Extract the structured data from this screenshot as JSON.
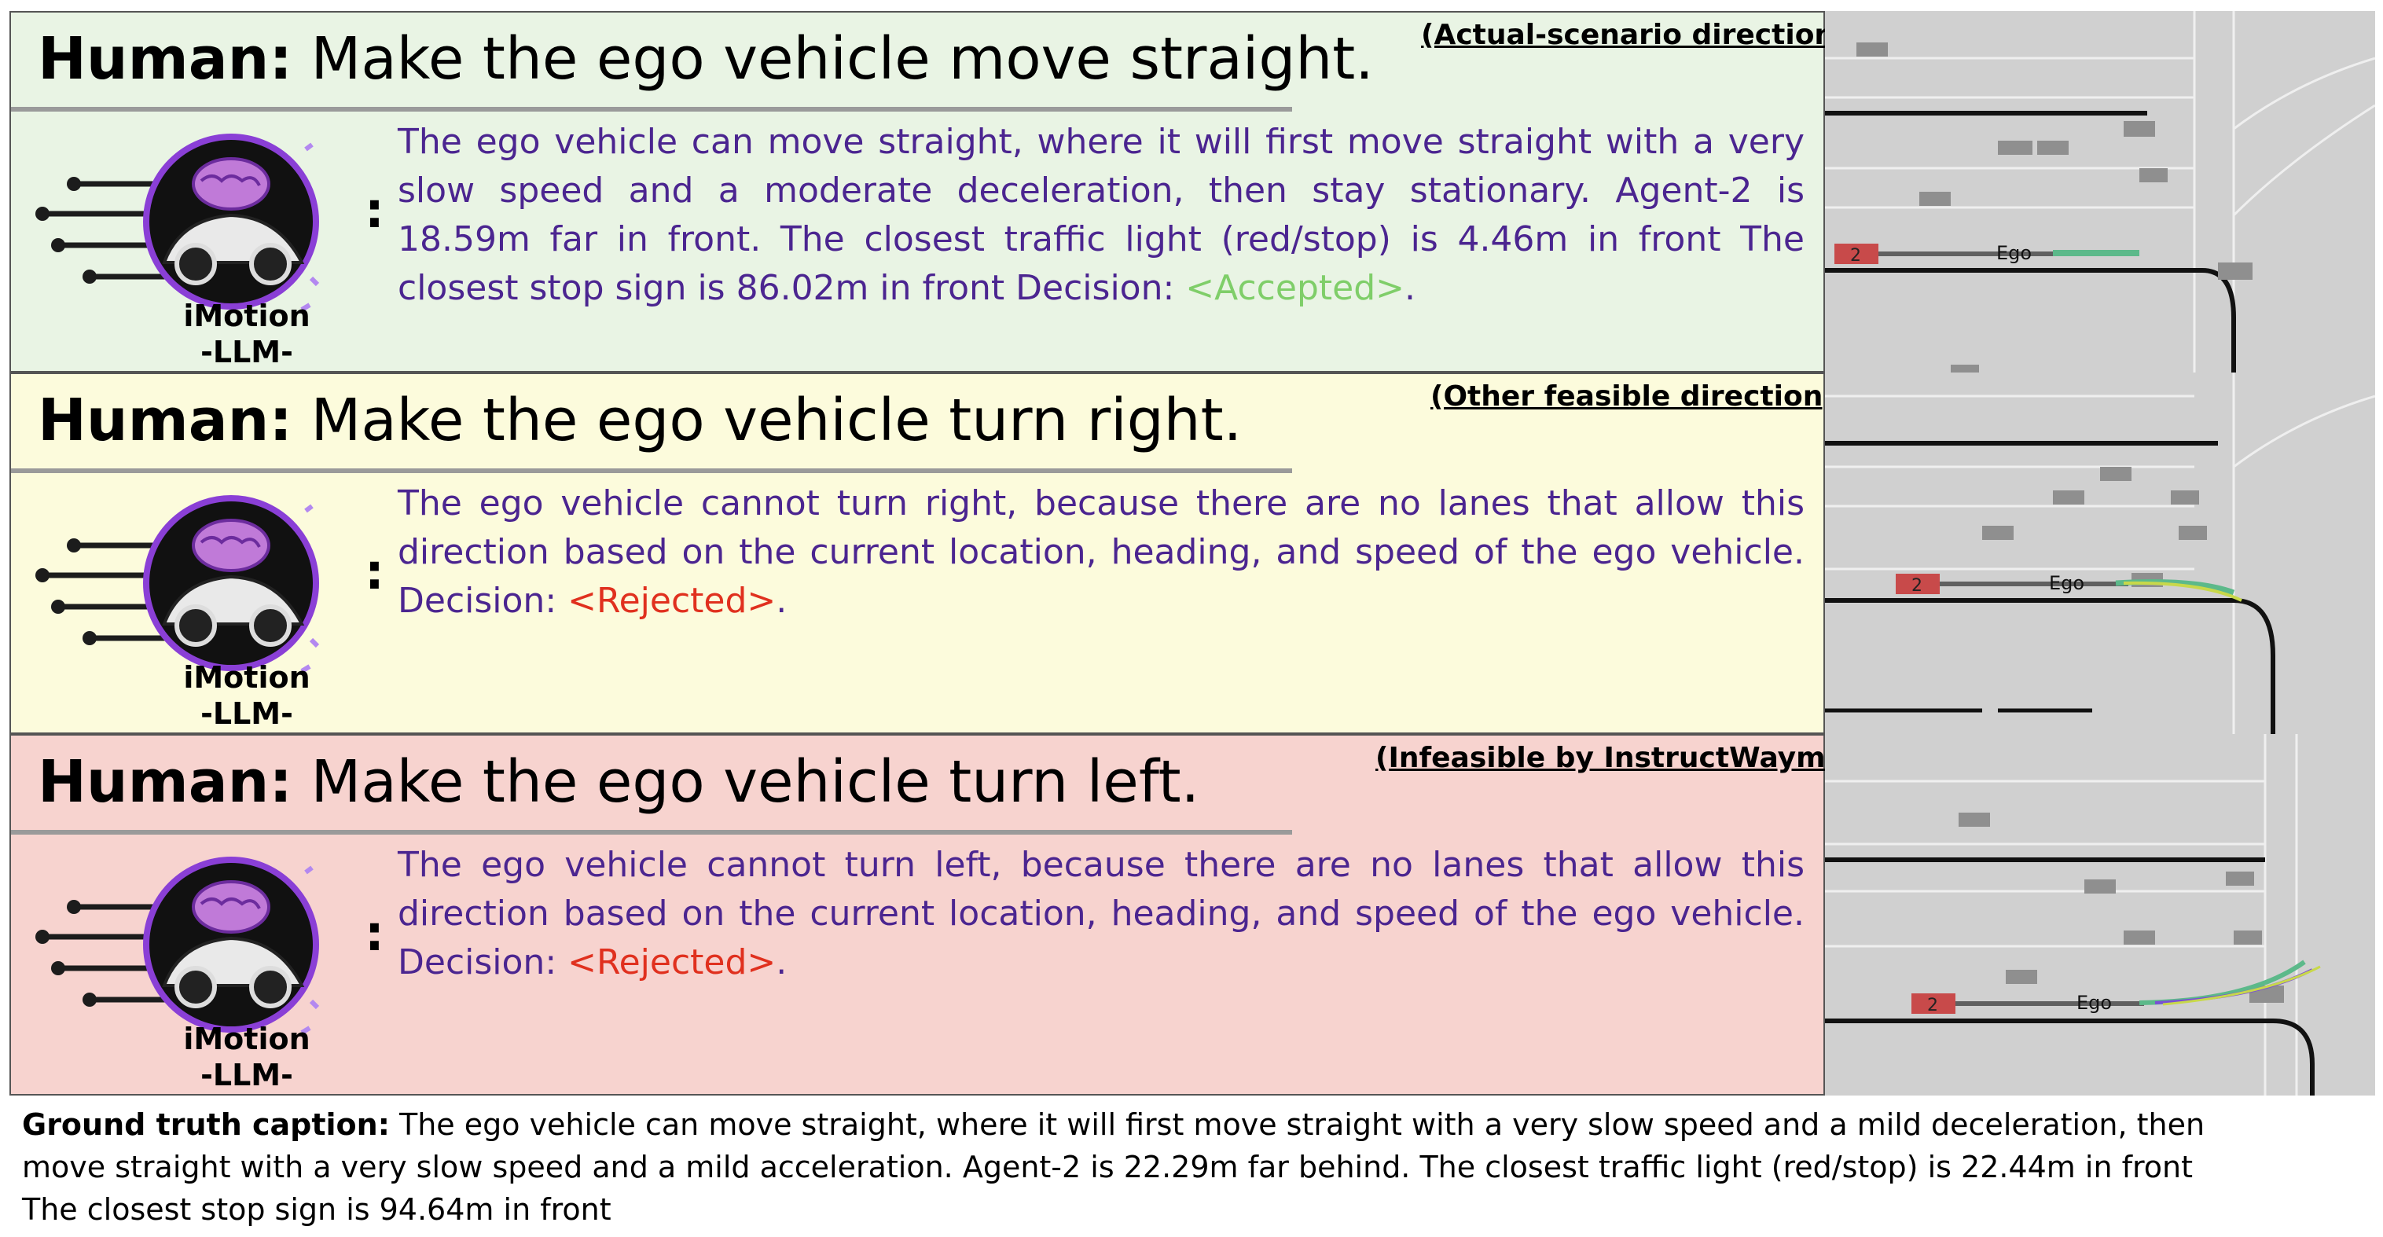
{
  "panels": [
    {
      "human_prefix": "Human:",
      "instruction": "Make the ego vehicle move straight.",
      "tag": "(Actual-scenario direction)",
      "logo_line1": "iMotion",
      "logo_line2": "-LLM-",
      "colon": ":",
      "response": "The ego vehicle can move straight, where it will first move straight with a very slow speed and a moderate deceleration, then stay stationary. Agent-2 is 18.59m far in front. The closest traffic light (red/stop) is 4.46m in front The closest stop sign is 86.02m in front Decision: ",
      "decision": "<Accepted>",
      "decision_color": "#7fce69",
      "after": ".",
      "scene": {
        "agent_label": "2",
        "ego_label": "Ego"
      }
    },
    {
      "human_prefix": "Human:",
      "instruction": "Make the ego vehicle turn right.",
      "tag": "(Other feasible direction)",
      "logo_line1": "iMotion",
      "logo_line2": "-LLM-",
      "colon": ":",
      "response": "The ego vehicle cannot turn right, because there are no lanes that allow this direction based on the current location, heading, and speed of the ego vehicle. Decision: ",
      "decision": "<Rejected>",
      "decision_color": "#e0301e",
      "after": ".",
      "scene": {
        "agent_label": "2",
        "ego_label": "Ego"
      }
    },
    {
      "human_prefix": "Human:",
      "instruction": "Make the ego vehicle turn left.",
      "tag": "(Infeasible by InstructWaymo)",
      "logo_line1": "iMotion",
      "logo_line2": "-LLM-",
      "colon": ":",
      "response": "The ego vehicle cannot turn left, because there are no lanes that allow this direction based on the current location, heading, and speed of the ego vehicle. Decision: ",
      "decision": "<Rejected>",
      "decision_color": "#e0301e",
      "after": ".",
      "scene": {
        "agent_label": "2",
        "ego_label": "Ego"
      }
    }
  ],
  "caption": {
    "label": "Ground truth caption:",
    "text": " The ego vehicle can move straight, where it will first move straight with a very slow speed and a mild deceleration, then move straight with a very slow speed and a mild acceleration. Agent-2 is 22.29m far behind. The closest traffic light (red/stop) is 22.44m in front The closest stop sign is 94.64m in front"
  },
  "colors": {
    "accepted": "#7fce69",
    "rejected": "#e0301e",
    "response_text": "#4b2590",
    "panel_green": "#e9f4e4",
    "panel_yellow": "#fcfbdc",
    "panel_red": "#f7d3cf"
  },
  "icons": [
    "brain-car-logo-icon",
    "map-scene-icon"
  ]
}
